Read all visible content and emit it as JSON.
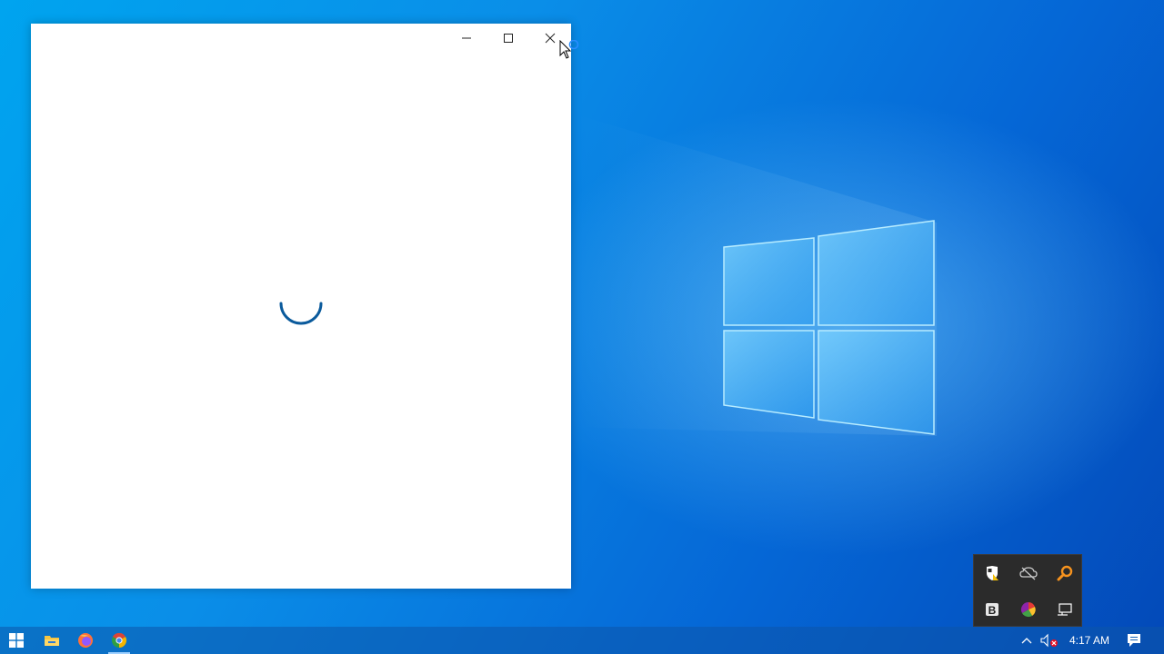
{
  "desktop": {
    "wallpaper": "windows-10-hero",
    "accent_color": "#0078d7"
  },
  "app_window": {
    "state": "loading",
    "controls": {
      "minimize_icon": "minimize-icon",
      "maximize_icon": "maximize-icon",
      "close_icon": "close-icon"
    },
    "spinner_color": "#0a5a9c"
  },
  "tray_flyout": {
    "icons": [
      "defender-warning-icon",
      "onedrive-offline-icon",
      "search-tool-icon",
      "bitdefender-icon",
      "color-wheel-icon",
      "network-icon"
    ]
  },
  "taskbar": {
    "pinned": [
      "start-icon",
      "file-explorer-icon",
      "firefox-icon",
      "chrome-icon"
    ],
    "system_tray": {
      "show_hidden_icon": "chevron-up-icon",
      "volume_icon": "volume-muted-icon",
      "clock": "4:17 AM",
      "notifications_icon": "action-center-icon"
    }
  }
}
